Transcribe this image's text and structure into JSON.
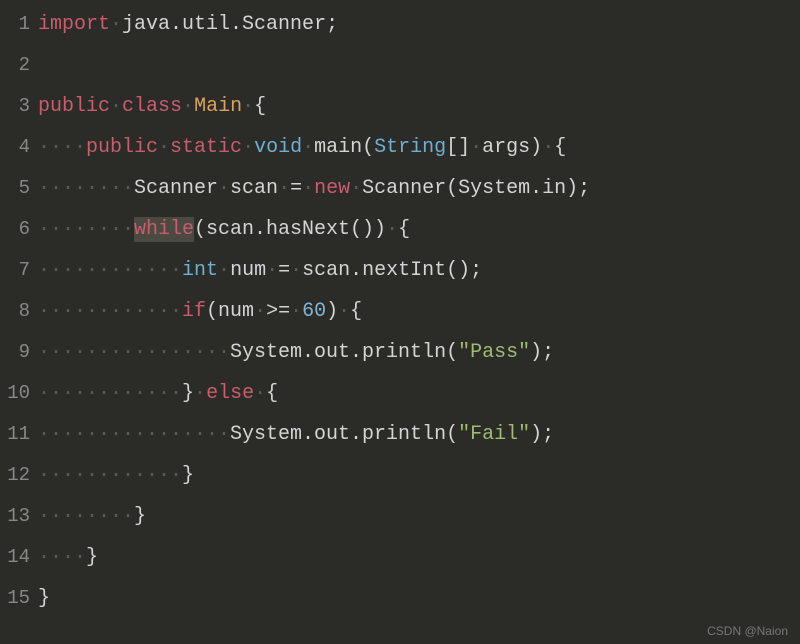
{
  "lineNumbers": [
    "1",
    "2",
    "3",
    "4",
    "5",
    "6",
    "7",
    "8",
    "9",
    "10",
    "11",
    "12",
    "13",
    "14",
    "15"
  ],
  "code": {
    "l1": {
      "import": "import",
      "ws1": "·",
      "pkg": "java.util.Scanner;"
    },
    "l3": {
      "public": "public",
      "ws1": "·",
      "class": "class",
      "ws2": "·",
      "name": "Main",
      "ws3": "·",
      "brace": "{"
    },
    "l4": {
      "ws1": "····",
      "public": "public",
      "ws2": "·",
      "static": "static",
      "ws3": "·",
      "void": "void",
      "ws4": "·",
      "main": "main(",
      "string": "String",
      "rest": "[]",
      "ws5": "·",
      "args": "args)",
      "ws6": "·",
      "brace": "{"
    },
    "l5": {
      "ws1": "········",
      "scanner1": "Scanner",
      "ws2": "·",
      "scan": "scan",
      "ws3": "·",
      "eq": "=",
      "ws4": "·",
      "new": "new",
      "ws5": "·",
      "scanner2": "Scanner(System.in);"
    },
    "l6": {
      "ws1": "········",
      "while": "while",
      "rest": "(scan.hasNext())",
      "ws2": "·",
      "brace": "{"
    },
    "l7": {
      "ws1": "············",
      "int": "int",
      "ws2": "·",
      "num": "num",
      "ws3": "·",
      "eq": "=",
      "ws4": "·",
      "rest": "scan.nextInt();"
    },
    "l8": {
      "ws1": "············",
      "if": "if",
      "p1": "(num",
      "ws2": "·",
      "op": ">=",
      "ws3": "·",
      "val": "60",
      "p2": ")",
      "ws4": "·",
      "brace": "{"
    },
    "l9": {
      "ws1": "················",
      "sys": "System.out.println(",
      "str": "\"Pass\"",
      "end": ");"
    },
    "l10": {
      "ws1": "············",
      "brace": "}",
      "ws2": "·",
      "else": "else",
      "ws3": "·",
      "brace2": "{"
    },
    "l11": {
      "ws1": "················",
      "sys": "System.out.println(",
      "str": "\"Fail\"",
      "end": ");"
    },
    "l12": {
      "ws1": "············",
      "brace": "}"
    },
    "l13": {
      "ws1": "········",
      "brace": "}"
    },
    "l14": {
      "ws1": "····",
      "brace": "}"
    },
    "l15": {
      "brace": "}"
    }
  },
  "watermark": "CSDN @Naion"
}
